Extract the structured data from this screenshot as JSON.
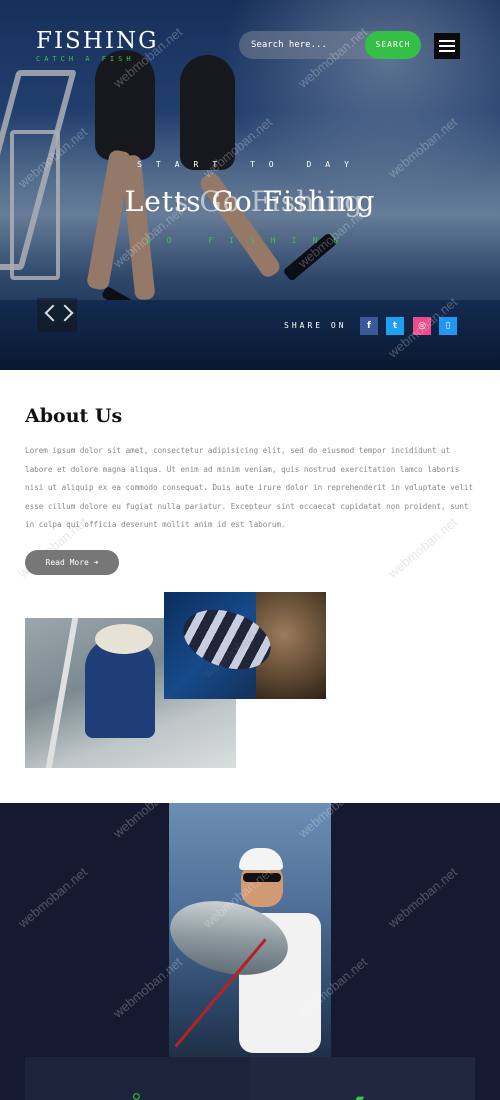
{
  "header": {
    "logo": "FISHING",
    "tagline": "CATCH A FISH",
    "search_placeholder": "Search here...",
    "search_button": "SEARCH"
  },
  "hero": {
    "pre_title": "START TO DAY",
    "title": "Letts Go Fishing",
    "ghost_title": "Lets Go Fishing",
    "post_title": "GO FISHING",
    "share_label": "SHARE ON",
    "social": [
      {
        "icon": "facebook-icon",
        "glyph": "f",
        "color": "#3b5998"
      },
      {
        "icon": "twitter-icon",
        "glyph": "t",
        "color": "#1da1f2"
      },
      {
        "icon": "dribbble-icon",
        "glyph": "◎",
        "color": "#ea4c89"
      },
      {
        "icon": "mobile-icon",
        "glyph": "▯",
        "color": "#2196f3"
      }
    ]
  },
  "about": {
    "title": "About Us",
    "text": "Lorem ipsum dolor sit amet, consectetur adipisicing elit, sed do eiusmod tempor incididunt ut labore et dolore magna aliqua. Ut enim ad minim veniam, quis nostrud exercitation lamco laboris nisi ut aliquip ex ea commodo consequat. Duis aute irure dolor in reprehenderit in voluptate velit esse cillum dolore eu fugiat nulla pariatur. Excepteur sint occaecat cupidatat non proident, sunt in culpa qui officia deserunt mollit anim id est laborum.",
    "button": "Read More ➜"
  },
  "watermark": "webmoban.net",
  "colors": {
    "accent": "#34c047",
    "dark_bg": "#151a30"
  }
}
